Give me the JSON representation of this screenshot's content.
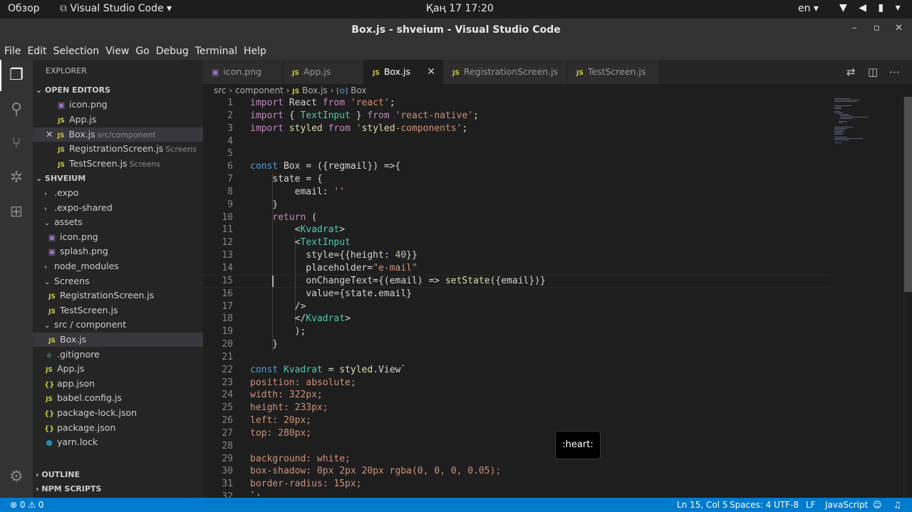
{
  "topbar": {
    "overview": "Обзор",
    "app_menu": "Visual Studio Code ▾",
    "clock": "Қаң 17  17:20",
    "lang": "en ▾",
    "sys_icons": "▼ ◀ ▮ ▾"
  },
  "window": {
    "title": "Box.js - shveium - Visual Studio Code",
    "min": "–",
    "max": "▫",
    "close": "✕"
  },
  "menu": [
    "File",
    "Edit",
    "Selection",
    "View",
    "Go",
    "Debug",
    "Terminal",
    "Help"
  ],
  "activity_icons": [
    "files-icon",
    "search-icon",
    "source-control-icon",
    "debug-icon",
    "extensions-icon",
    "settings-gear-icon"
  ],
  "sidebar": {
    "title": "EXPLORER",
    "open_editors_label": "OPEN EDITORS",
    "open_editors": [
      {
        "icon": "img",
        "name": "icon.png",
        "hint": ""
      },
      {
        "icon": "js",
        "name": "App.js",
        "hint": ""
      },
      {
        "icon": "js",
        "name": "Box.js",
        "hint": "src/component"
      },
      {
        "icon": "js",
        "name": "RegistrationScreen.js",
        "hint": "Screens"
      },
      {
        "icon": "js",
        "name": "TestScreen.js",
        "hint": "Screens"
      }
    ],
    "project_label": "SHVEIUM",
    "tree": [
      {
        "kind": "folder",
        "name": ".expo",
        "open": false,
        "depth": 1
      },
      {
        "kind": "folder",
        "name": ".expo-shared",
        "open": false,
        "depth": 1
      },
      {
        "kind": "folder",
        "name": "assets",
        "open": true,
        "depth": 1
      },
      {
        "kind": "img",
        "name": "icon.png",
        "depth": 2
      },
      {
        "kind": "img",
        "name": "splash.png",
        "depth": 2
      },
      {
        "kind": "folder",
        "name": "node_modules",
        "open": false,
        "depth": 1
      },
      {
        "kind": "folder",
        "name": "Screens",
        "open": true,
        "depth": 1
      },
      {
        "kind": "js",
        "name": "RegistrationScreen.js",
        "depth": 2
      },
      {
        "kind": "js",
        "name": "TestScreen.js",
        "depth": 2
      },
      {
        "kind": "folder",
        "name": "src / component",
        "open": true,
        "depth": 1
      },
      {
        "kind": "js",
        "name": "Box.js",
        "depth": 2,
        "selected": true
      },
      {
        "kind": "git",
        "name": ".gitignore",
        "depth": 1
      },
      {
        "kind": "js",
        "name": "App.js",
        "depth": 1
      },
      {
        "kind": "json",
        "name": "app.json",
        "depth": 1
      },
      {
        "kind": "js",
        "name": "babel.config.js",
        "depth": 1
      },
      {
        "kind": "json",
        "name": "package-lock.json",
        "depth": 1
      },
      {
        "kind": "json",
        "name": "package.json",
        "depth": 1
      },
      {
        "kind": "yarn",
        "name": "yarn.lock",
        "depth": 1
      }
    ],
    "outline_label": "OUTLINE",
    "npm_label": "NPM SCRIPTS"
  },
  "tabs": [
    {
      "icon": "img",
      "name": "icon.png",
      "active": false
    },
    {
      "icon": "js",
      "name": "App.js",
      "active": false
    },
    {
      "icon": "js",
      "name": "Box.js",
      "active": true
    },
    {
      "icon": "js",
      "name": "RegistrationScreen.js",
      "active": false
    },
    {
      "icon": "js",
      "name": "TestScreen.js",
      "active": false
    }
  ],
  "breadcrumb": {
    "p1": "src",
    "p2": "component",
    "file": "Box.js",
    "symbol": "Box"
  },
  "code_lines": [
    "import React from 'react';",
    "import { TextInput } from 'react-native';",
    "import styled from 'styled-components';",
    "",
    "",
    "const Box = ({regmail}) =>{",
    "    state = {",
    "        email: ''",
    "    }",
    "    return (",
    "        <Kvadrat>",
    "        <TextInput",
    "          style={{height: 40}}",
    "          placeholder=\"e-mail\"",
    "          onChangeText={(email) => setState({email})}",
    "          value={state.email}",
    "        />",
    "        </Kvadrat>",
    "        );",
    "    }",
    "",
    "const Kvadrat = styled.View`",
    "position: absolute;",
    "width: 322px;",
    "height: 233px;",
    "left: 20px;",
    "top: 280px;",
    "",
    "background: white;",
    "box-shadow: 0px 2px 20px rgba(0, 0, 0, 0.05);",
    "border-radius: 15px;",
    "`;"
  ],
  "tooltip": ":heart:",
  "status": {
    "problems": "⊗ 0 ⚠ 0",
    "position": "Ln 15, Col 5",
    "spaces": "Spaces: 4",
    "encoding": "UTF-8",
    "eol": "LF",
    "language": "JavaScript"
  },
  "colors": {
    "statusbar": "#007acc",
    "sidebar": "#252526",
    "editor": "#1e1e1e",
    "keyword": "#569cd6",
    "string": "#ce9178"
  }
}
